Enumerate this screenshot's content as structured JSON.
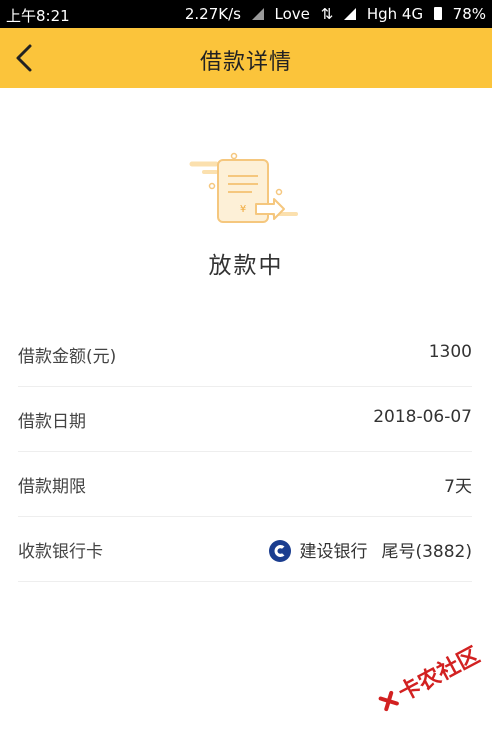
{
  "status_bar": {
    "time": "上午8:21",
    "speed": "2.27K/s",
    "carrier1": "Love",
    "carrier2": "Hgh 4G",
    "battery": "78%"
  },
  "header": {
    "title": "借款详情"
  },
  "loan_status": {
    "text": "放款中"
  },
  "details": [
    {
      "label": "借款金额(元)",
      "value": "1300"
    },
    {
      "label": "借款日期",
      "value": "2018-06-07"
    },
    {
      "label": "借款期限",
      "value": "7天"
    },
    {
      "label": "收款银行卡",
      "bank_name": "建设银行",
      "card_tail": "尾号(3882)"
    }
  ],
  "watermark": {
    "text": "卡农社区"
  },
  "colors": {
    "header_bg": "#fbc43b",
    "accent": "#fbc43b",
    "bank_logo": "#1a3d8f"
  }
}
